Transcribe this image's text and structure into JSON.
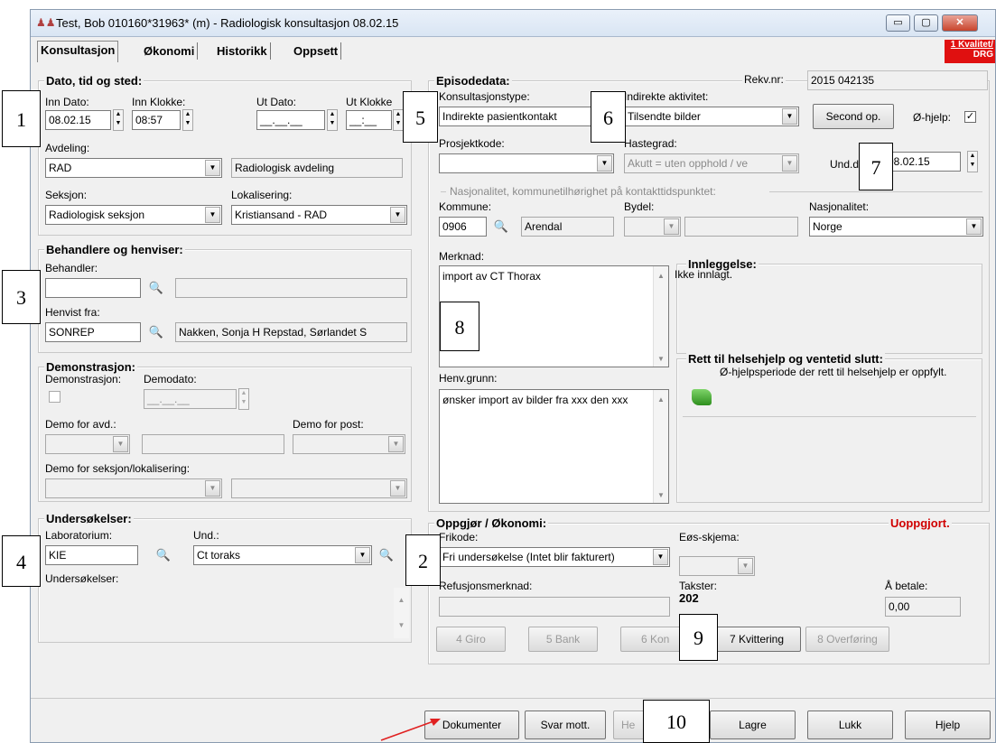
{
  "window": {
    "title": "Test, Bob  010160*31963* (m) - Radiologisk konsultasjon 08.02.15",
    "app_icon": "people-icon",
    "buttons": {
      "minimize": "▭",
      "maximize": "▢",
      "close": "✕"
    }
  },
  "tabs": [
    {
      "label": "Konsultasjon",
      "active": true
    },
    {
      "label": "Økonomi"
    },
    {
      "label": "Historikk"
    },
    {
      "label": "Oppsett"
    }
  ],
  "quality_badge": {
    "line1": "1 Kvalitet/",
    "line2": "DRG",
    "color": "#e01010"
  },
  "dato": {
    "title": "Dato, tid og sted:",
    "inn_dato_label": "Inn Dato:",
    "inn_dato": "08.02.15",
    "inn_klokke_label": "Inn Klokke:",
    "inn_klokke": "08:57",
    "ut_dato_label": "Ut Dato:",
    "ut_dato": "__.__.__",
    "ut_klokke_label": "Ut Klokke",
    "ut_klokke": "__:__",
    "avdeling_label": "Avdeling:",
    "avdeling": "RAD",
    "avdeling_name": "Radiologisk avdeling",
    "seksjon_label": "Seksjon:",
    "seksjon": "Radiologisk seksjon",
    "lokalisering_label": "Lokalisering:",
    "lokalisering": "Kristiansand - RAD"
  },
  "behandlere": {
    "title": "Behandlere og henviser:",
    "behandler_label": "Behandler:",
    "behandler": "",
    "henvist_label": "Henvist fra:",
    "henvist": "SONREP",
    "henvist_name": "Nakken, Sonja H Repstad, Sørlandet S"
  },
  "demo": {
    "title": "Demonstrasjon:",
    "demonstrasjon_label": "Demonstrasjon:",
    "demodato_label": "Demodato:",
    "demodato": "__.__.__",
    "avd_label": "Demo for avd.:",
    "post_label": "Demo for post:",
    "seksjon_label": "Demo for seksjon/lokalisering:"
  },
  "undersokelser": {
    "title": "Undersøkelser:",
    "lab_label": "Laboratorium:",
    "lab": "KIE",
    "und_label": "Und.:",
    "und": "Ct toraks",
    "list_label": "Undersøkelser:"
  },
  "episode": {
    "title": "Episodedata:",
    "rekv_label": "Rekv.nr:",
    "rekv": "2015 042135",
    "konsultasjonstype_label": "Konsultasjonstype:",
    "konsultasjonstype": "Indirekte pasientkontakt",
    "indirekte_label": "Indirekte aktivitet:",
    "indirekte": "Tilsendte bilder",
    "second_op": "Second op.",
    "ohjelp_label": "Ø-hjelp:",
    "prosjektkode_label": "Prosjektkode:",
    "hastegrad_label": "Hastegrad:",
    "hastegrad": "Akutt = uten opphold / ve",
    "und_dato_label": "Und.da",
    "und_dato": "08.02.15",
    "nasjonalitet_group": "Nasjonalitet, kommunetilhørighet på kontakttidspunktet:",
    "kommune_label": "Kommune:",
    "kommune": "0906",
    "kommune_name": "Arendal",
    "bydel_label": "Bydel:",
    "nasjonalitet_label": "Nasjonalitet:",
    "nasjonalitet": "Norge",
    "merknad_label": "Merknad:",
    "merknad": "import av CT Thorax",
    "innleggelse_title": "Innleggelse:",
    "innleggelse": "Ikke innlagt.",
    "rett_title": "Rett til helsehjelp og ventetid slutt:",
    "rett_text": "Ø-hjelpsperiode der rett til helsehjelp er oppfylt.",
    "henv_label": "Henv.grunn:",
    "henv": "ønsker import av bilder fra xxx den xxx"
  },
  "oppgjor": {
    "title": "Oppgjør / Økonomi:",
    "status": "Uoppgjort.",
    "status_color": "#d00000",
    "frikode_label": "Frikode:",
    "frikode": "Fri undersøkelse (Intet blir fakturert)",
    "eos_label": "Eøs-skjema:",
    "refusjon_label": "Refusjonsmerknad:",
    "takster_label": "Takster:",
    "takster": "202",
    "abetale_label": "Å betale:",
    "abetale": "0,00",
    "buttons": [
      "4 Giro",
      "5 Bank",
      "6 Kon",
      "7 Kvittering",
      "8 Overføring"
    ]
  },
  "bottom": {
    "dokumenter": "Dokumenter",
    "svar": "Svar mott.",
    "he": "He",
    "lagre": "Lagre",
    "lukk": "Lukk",
    "hjelp": "Hjelp"
  },
  "callouts": [
    "1",
    "2",
    "3",
    "4",
    "5",
    "6",
    "7",
    "8",
    "9",
    "10"
  ],
  "arrow_color": "#e02020"
}
